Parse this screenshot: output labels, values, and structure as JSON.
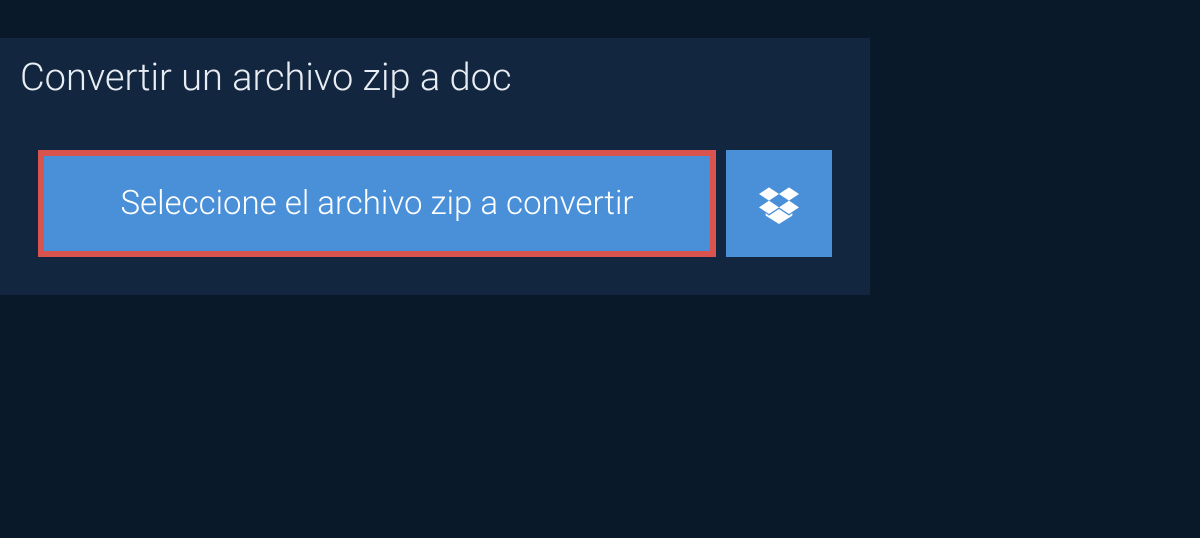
{
  "title": "Convertir un archivo zip a doc",
  "select_button_label": "Seleccione el archivo zip a convertir"
}
